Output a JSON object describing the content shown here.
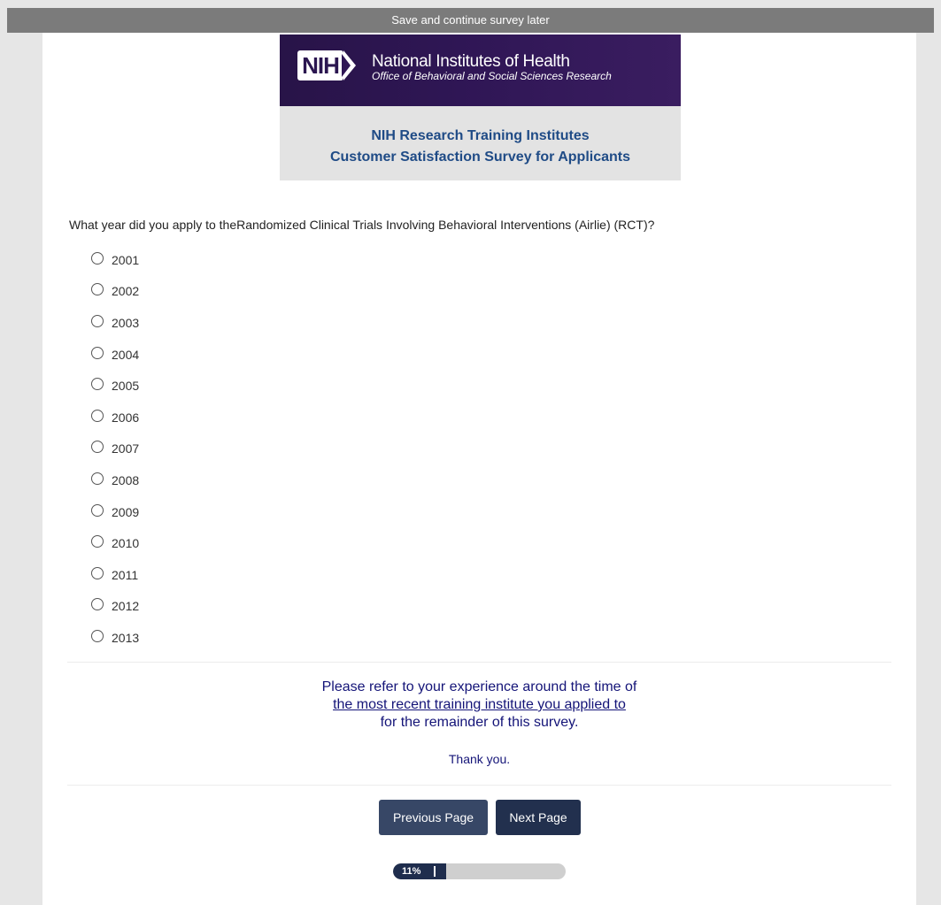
{
  "save_bar": {
    "label": "Save and continue survey later"
  },
  "banner": {
    "logo_text": "NIH",
    "org_name": "National Institutes of Health",
    "office_name": "Office of Behavioral and Social Sciences Research",
    "title_line1": "NIH Research Training Institutes",
    "title_line2": "Customer Satisfaction Survey for Applicants"
  },
  "question": {
    "text": "What year did you apply to theRandomized Clinical Trials Involving Behavioral Interventions (Airlie) (RCT)?",
    "options": [
      "2001",
      "2002",
      "2003",
      "2004",
      "2005",
      "2006",
      "2007",
      "2008",
      "2009",
      "2010",
      "2011",
      "2012",
      "2013"
    ],
    "selected": null
  },
  "notice": {
    "line1": "Please refer to your experience around the time of",
    "link_text": "the most recent training institute you applied to",
    "line3": "for the remainder of this survey.",
    "thanks": "Thank you."
  },
  "navigation": {
    "previous_label": "Previous Page",
    "next_label": "Next Page"
  },
  "progress": {
    "label": "11%",
    "fraction": 0.11
  },
  "colors": {
    "banner_purple": "#2f1655",
    "banner_title_blue": "#1f4b86",
    "notice_navy": "#141478",
    "button_bg": "#374766",
    "progress_fill": "#1f2d4d"
  }
}
